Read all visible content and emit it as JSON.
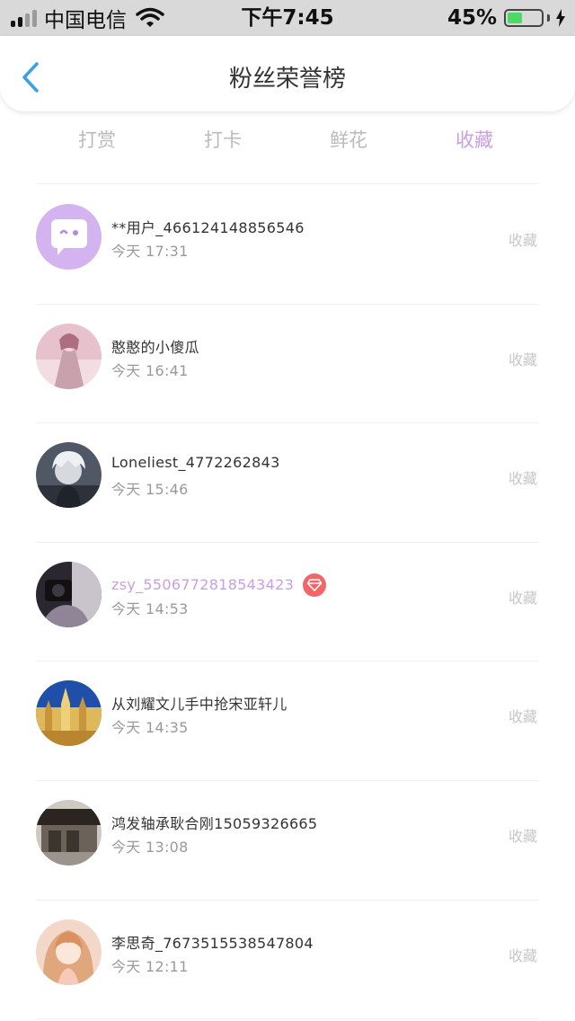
{
  "status_bar": {
    "carrier": "中国电信",
    "time": "下午7:45",
    "battery_percent": "45%",
    "battery_level": 0.45,
    "signal_bars_filled": 2,
    "icons": [
      "signal-icon",
      "wifi-icon",
      "battery-icon",
      "charging-bolt-icon"
    ]
  },
  "nav": {
    "title": "粉丝荣誉榜",
    "back_icon": "chevron-left-icon",
    "accent_color": "#3aa0e8"
  },
  "tabs": [
    {
      "label": "打赏",
      "active": false
    },
    {
      "label": "打卡",
      "active": false
    },
    {
      "label": "鲜花",
      "active": false
    },
    {
      "label": "收藏",
      "active": true
    }
  ],
  "colors": {
    "active_tab": "#c89ee6",
    "inactive_tab": "#bbbbbb",
    "vip_name": "#c89ee6",
    "vip_badge": "#f2666a"
  },
  "list": [
    {
      "name": "**用户_466124148856546",
      "time": "今天 17:31",
      "action": "收藏",
      "vip": false,
      "avatar": "default-chat-avatar"
    },
    {
      "name": "憨憨的小傻瓜",
      "time": "今天 16:41",
      "action": "收藏",
      "vip": false,
      "avatar": "user-photo-avatar"
    },
    {
      "name": "Loneliest_4772262843",
      "time": "今天 15:46",
      "action": "收藏",
      "vip": false,
      "avatar": "user-photo-avatar"
    },
    {
      "name": "zsy_5506772818543423",
      "time": "今天 14:53",
      "action": "收藏",
      "vip": true,
      "avatar": "user-photo-avatar",
      "badge_icon": "diamond-icon"
    },
    {
      "name": "从刘耀文儿手中抢宋亚轩儿",
      "time": "今天 14:35",
      "action": "收藏",
      "vip": false,
      "avatar": "user-photo-avatar"
    },
    {
      "name": "鸿发轴承耿合刚15059326665",
      "time": "今天 13:08",
      "action": "收藏",
      "vip": false,
      "avatar": "user-photo-avatar"
    },
    {
      "name": "李思奇_7673515538547804",
      "time": "今天 12:11",
      "action": "收藏",
      "vip": false,
      "avatar": "user-photo-avatar"
    }
  ]
}
